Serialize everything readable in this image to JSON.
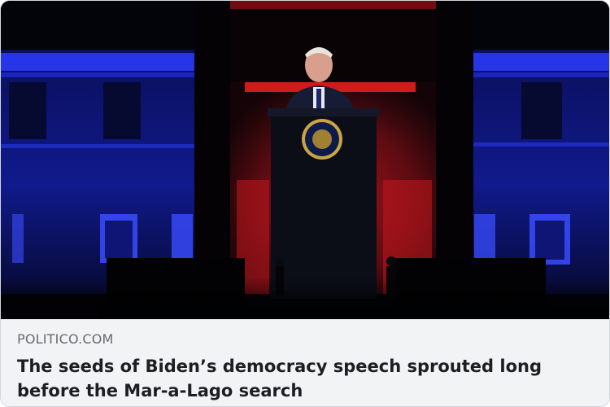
{
  "link_preview": {
    "source": "POLITICO.COM",
    "headline": "The seeds of Biden’s democracy speech sprouted long before the Mar-a-Lago search"
  },
  "colors": {
    "blue_light": "#2a3cff",
    "red_light": "#e0201c",
    "card_background": "#f1f3f5",
    "headline_text": "#1c1e21",
    "source_text": "#656b73"
  },
  "icons": {
    "podium_seal": "presidential-seal-icon"
  }
}
